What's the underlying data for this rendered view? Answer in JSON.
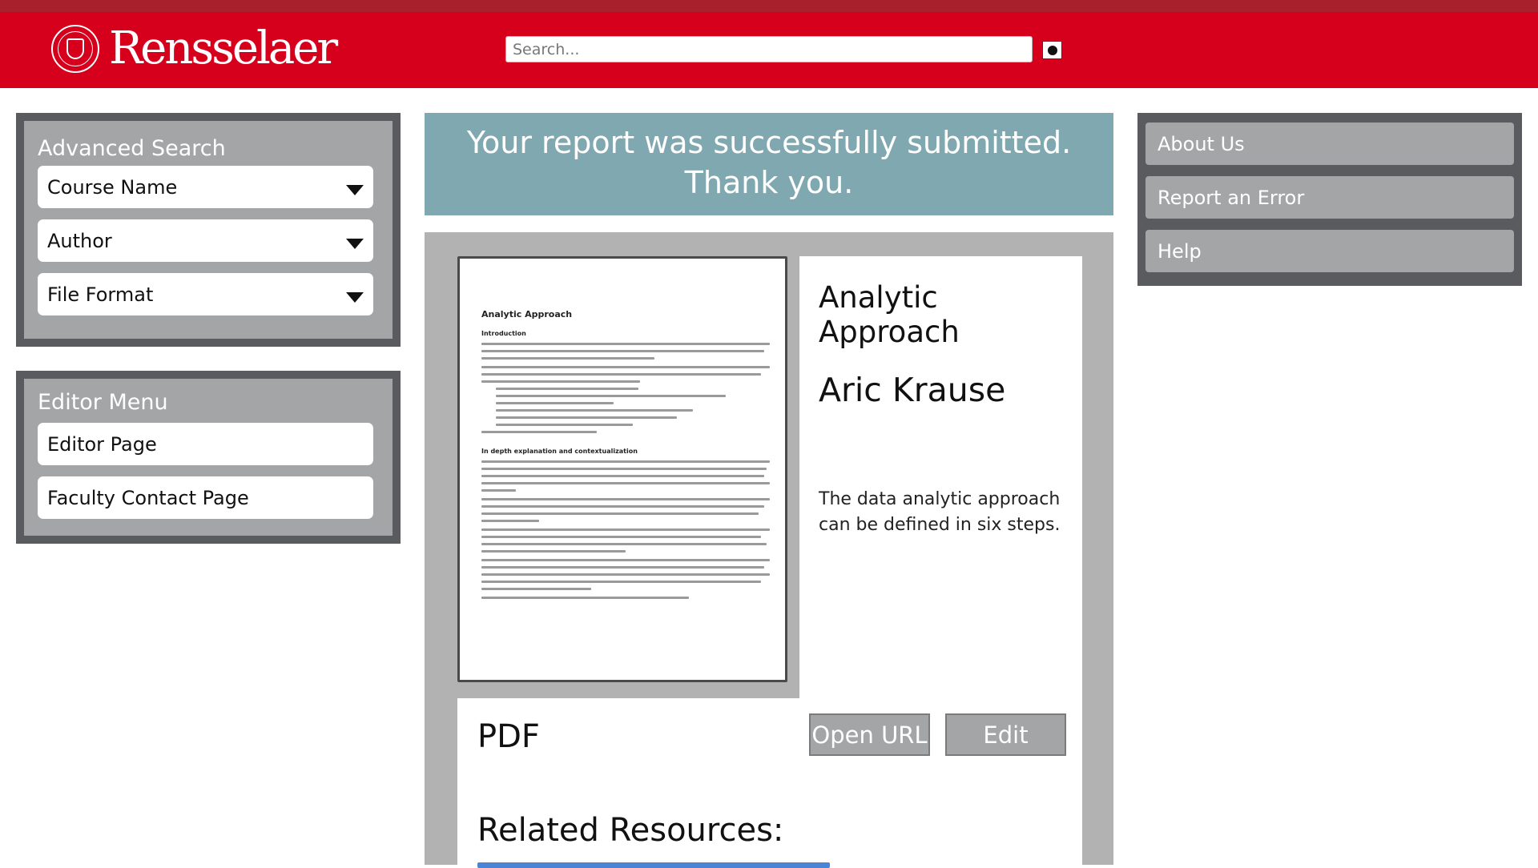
{
  "header": {
    "brand": "Rensselaer",
    "search_placeholder": "Search..."
  },
  "advanced_search": {
    "title": "Advanced Search",
    "fields": [
      "Course Name",
      "Author",
      "File Format"
    ]
  },
  "editor_menu": {
    "title": "Editor Menu",
    "items": [
      "Editor Page",
      "Faculty Contact Page"
    ]
  },
  "banner": {
    "line1": "Your report was successfully submitted.",
    "line2": "Thank you."
  },
  "document": {
    "title": "Analytic Approach",
    "section1": "Introduction",
    "section2": "In depth explanation and contextualization"
  },
  "resource": {
    "title": "Analytic Approach",
    "author": "Aric Krause",
    "description": "The data analytic approach can be defined in six steps.",
    "format": "PDF",
    "open_label": "Open URL",
    "edit_label": "Edit",
    "related_title": "Related Resources:"
  },
  "right_menu": {
    "items": [
      "About Us",
      "Report an Error",
      "Help"
    ]
  },
  "colors": {
    "brand_red": "#d6001c",
    "top_strip": "#a7202c",
    "banner_teal": "#80a8b0",
    "panel_dark": "#595b5e",
    "panel_light": "#a4a5a7"
  }
}
